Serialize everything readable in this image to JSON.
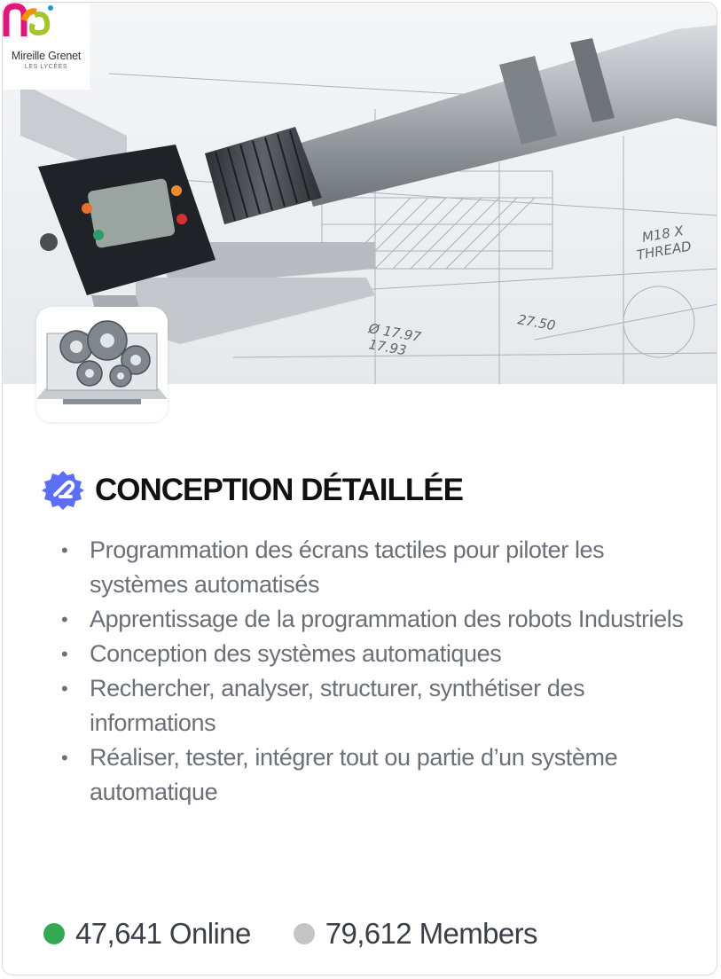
{
  "logo": {
    "name": "Mireille Grenet",
    "subtitle": "LES LYCÉES"
  },
  "group": {
    "title": "CONCEPTION DÉTAILLÉE",
    "bullets": [
      "Programmation des écrans tactiles pour piloter les systèmes automatisés",
      "Apprentissage de la programmation des robots Industriels",
      "Conception des systèmes automatiques",
      "Rechercher, analyser, structurer, synthétiser des informations",
      "Réaliser, tester, intégrer tout ou partie d’un système automatique"
    ]
  },
  "stats": {
    "online": "47,641 Online",
    "members": "79,612 Members"
  },
  "colors": {
    "online_dot": "#34a853",
    "members_dot": "#c5c5c5",
    "badge": "#5b6ef5",
    "bullet_text": "#6b7078"
  },
  "icons": {
    "badge": "verified-badge-icon",
    "online": "online-status-icon",
    "members": "members-status-icon"
  }
}
